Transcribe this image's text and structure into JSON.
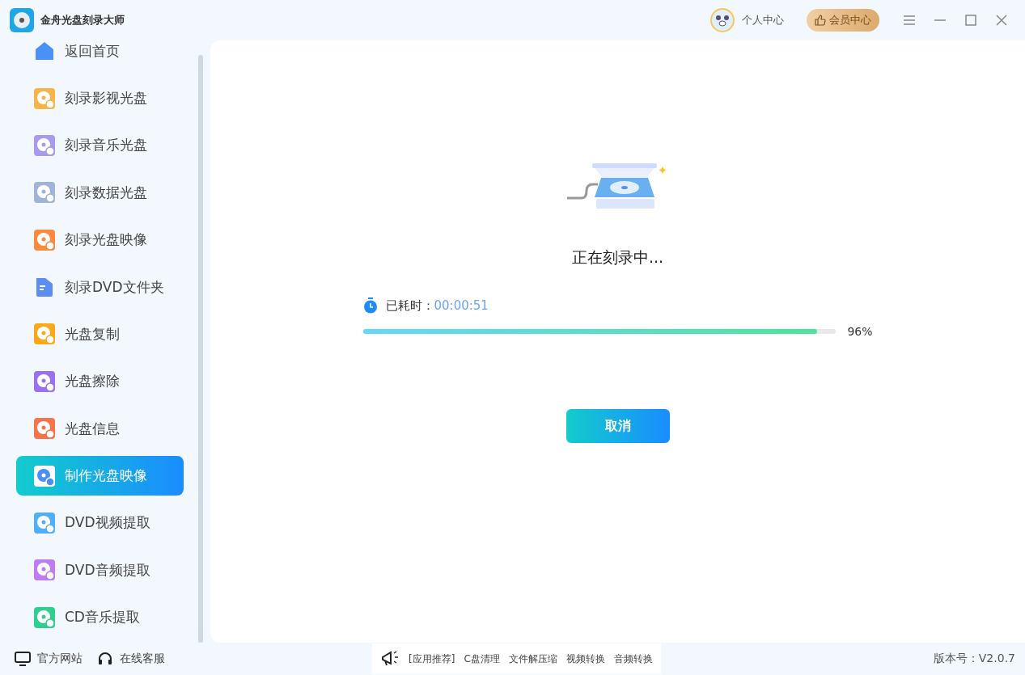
{
  "window": {
    "title": "金舟光盘刻录大师"
  },
  "header": {
    "user_center": "个人中心",
    "vip_center": "会员中心"
  },
  "sidebar": {
    "items": [
      {
        "label": "返回首页",
        "kind": "home",
        "color": "#4a90f5",
        "selected": false
      },
      {
        "label": "刻录影视光盘",
        "kind": "disc",
        "color": "#f7b548",
        "selected": false
      },
      {
        "label": "刻录音乐光盘",
        "kind": "disc",
        "color": "#a99af0",
        "selected": false
      },
      {
        "label": "刻录数据光盘",
        "kind": "disc",
        "color": "#9fb4d8",
        "selected": false
      },
      {
        "label": "刻录光盘映像",
        "kind": "disc",
        "color": "#fa8a3c",
        "selected": false
      },
      {
        "label": "刻录DVD文件夹",
        "kind": "folder",
        "color": "#5a8ef5",
        "selected": false
      },
      {
        "label": "光盘复制",
        "kind": "disc",
        "color": "#f9a81a",
        "selected": false
      },
      {
        "label": "光盘擦除",
        "kind": "disc",
        "color": "#9a72f0",
        "selected": false
      },
      {
        "label": "光盘信息",
        "kind": "disc",
        "color": "#f7734a",
        "selected": false
      },
      {
        "label": "制作光盘映像",
        "kind": "disc",
        "color": "#4a8ff5",
        "selected": true
      },
      {
        "label": "DVD视频提取",
        "kind": "disc",
        "color": "#4fb0f7",
        "selected": false
      },
      {
        "label": "DVD音频提取",
        "kind": "disc",
        "color": "#c07af2",
        "selected": false
      },
      {
        "label": "CD音乐提取",
        "kind": "disc",
        "color": "#2fcf8f",
        "selected": false
      }
    ],
    "footer": [
      "官方网站",
      "在线客服"
    ]
  },
  "progress": {
    "status": "正在刻录中...",
    "elapsed_label": "已耗时：",
    "elapsed": "00:00:51",
    "level": 0.96,
    "percent": "96%",
    "cancel": "取消"
  },
  "status_bar": {
    "recommend": [
      "[应用推荐]",
      "C盘清理",
      "文件解压缩",
      "视频转换",
      "音频转换"
    ],
    "version": "版本号：V2.0.7"
  }
}
